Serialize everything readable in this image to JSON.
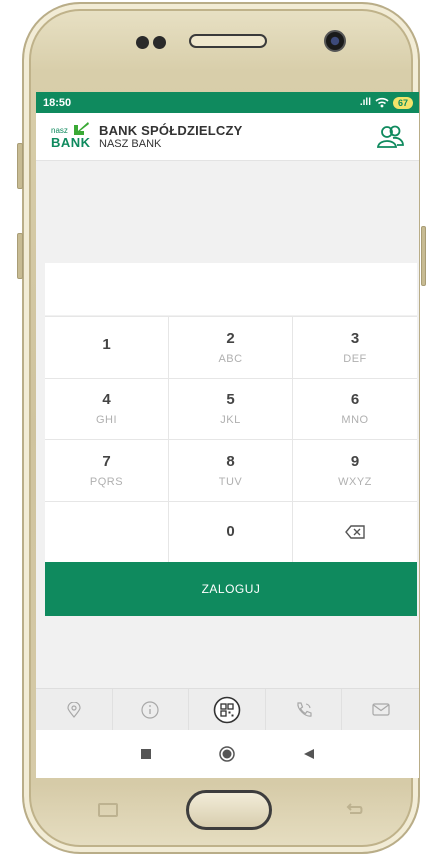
{
  "status_bar": {
    "time": "18:50",
    "signal": ".ıll",
    "wifi": "wifi-icon",
    "battery": "67"
  },
  "header": {
    "bank_name": "BANK SPÓŁDZIELCZY",
    "bank_subtitle": "NASZ BANK",
    "logo_small": "nasz",
    "logo_big": "BANK"
  },
  "pin": {
    "value": ""
  },
  "keypad": [
    {
      "digit": "1",
      "letters": ""
    },
    {
      "digit": "2",
      "letters": "ABC"
    },
    {
      "digit": "3",
      "letters": "DEF"
    },
    {
      "digit": "4",
      "letters": "GHI"
    },
    {
      "digit": "5",
      "letters": "JKL"
    },
    {
      "digit": "6",
      "letters": "MNO"
    },
    {
      "digit": "7",
      "letters": "PQRS"
    },
    {
      "digit": "8",
      "letters": "TUV"
    },
    {
      "digit": "9",
      "letters": "WXYZ"
    },
    {
      "digit": "",
      "letters": ""
    },
    {
      "digit": "0",
      "letters": ""
    },
    {
      "digit": "",
      "letters": "",
      "icon": "backspace-icon"
    }
  ],
  "login_button": {
    "label": "ZALOGUJ"
  },
  "bottom_nav": {
    "items": [
      {
        "icon": "location-pin-icon"
      },
      {
        "icon": "info-icon"
      },
      {
        "icon": "qr-code-icon"
      },
      {
        "icon": "phone-icon"
      },
      {
        "icon": "mail-icon"
      }
    ]
  },
  "colors": {
    "brand": "#0f8a5e",
    "background": "#f1f1f1",
    "key_letters": "#b0b0b0"
  }
}
